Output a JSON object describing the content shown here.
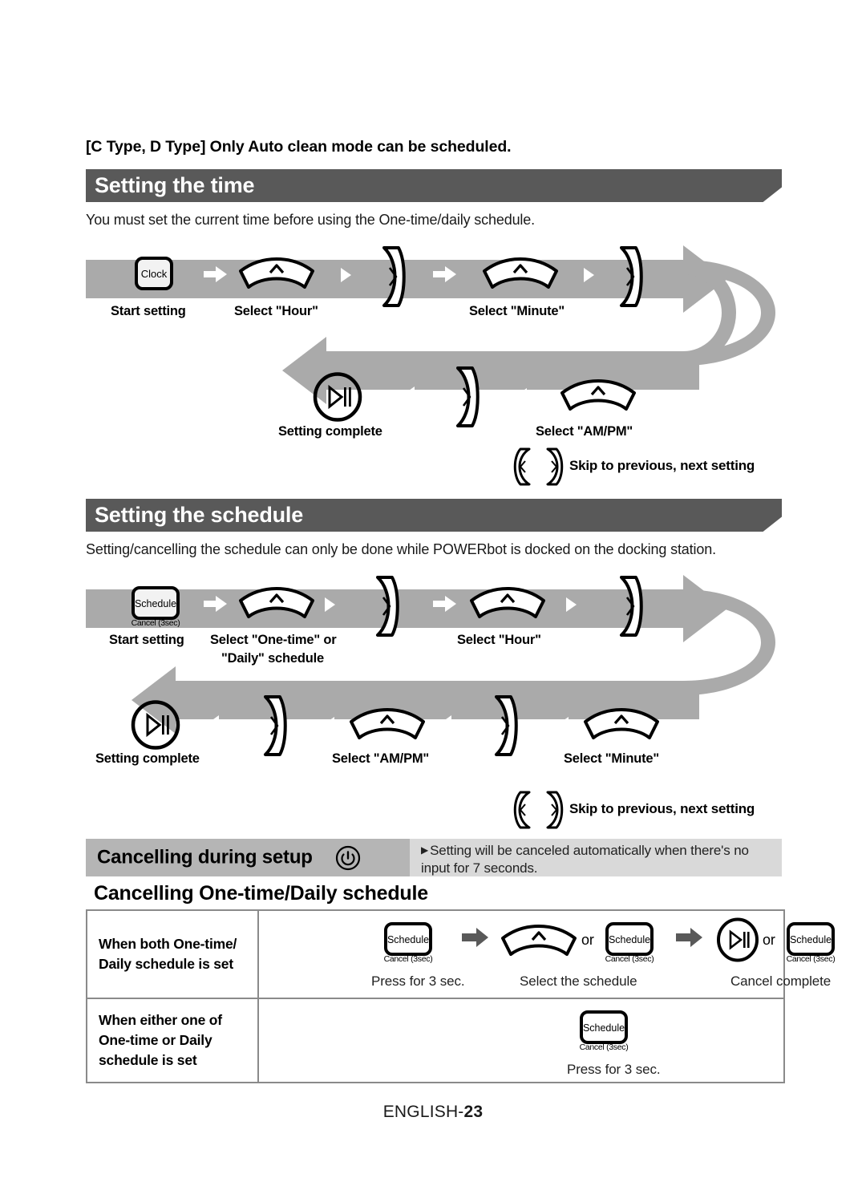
{
  "top_note": "[C Type, D Type] Only Auto clean mode can be scheduled.",
  "section_time": {
    "heading": "Setting the time",
    "intro": "You must set the current time before using the One-time/daily schedule.",
    "row1_labels": {
      "start": "Start setting",
      "hour": "Select \"Hour\"",
      "minute": "Select \"Minute\""
    },
    "row2_labels": {
      "complete": "Setting complete",
      "ampm": "Select \"AM/PM\""
    },
    "clock_button": "Clock",
    "legend": "Skip to previous, next setting"
  },
  "section_schedule": {
    "heading": "Setting the schedule",
    "intro": "Setting/cancelling the schedule can only be done while POWERbot is docked on the docking station.",
    "row1_labels": {
      "start": "Start setting",
      "mode_line1": "Select \"One-time\" or",
      "mode_line2": "\"Daily\" schedule",
      "hour": "Select \"Hour\""
    },
    "row2_labels": {
      "complete": "Setting complete",
      "ampm": "Select \"AM/PM\"",
      "minute": "Select \"Minute\""
    },
    "schedule_button": "Schedule",
    "schedule_button_sub": "Cancel (3sec)",
    "legend": "Skip to previous, next setting"
  },
  "cancelling_setup": {
    "title": "Cancelling during setup",
    "note_line1": "Setting will be canceled automatically when there's no",
    "note_line2": "input for 7 seconds.",
    "bullet": "▶"
  },
  "cancelling_schedule": {
    "title": "Cancelling One-time/Daily schedule",
    "rows": [
      {
        "label_line1": "When both One-time/",
        "label_line2": "Daily schedule is set",
        "steps": [
          {
            "caption": "Press for 3 sec."
          },
          {
            "caption": "Select the schedule"
          },
          {
            "caption": "Cancel complete"
          }
        ],
        "or_text": "or"
      },
      {
        "label_line1": "When either one of",
        "label_line2": "One-time or Daily",
        "label_line3": "schedule is set",
        "steps": [
          {
            "caption": "Press for 3 sec."
          }
        ]
      }
    ],
    "schedule_button": "Schedule",
    "schedule_button_sub": "Cancel (3sec)"
  },
  "footer": {
    "lang": "ENGLISH-",
    "page": "23"
  },
  "colors": {
    "section_bar": "#595959",
    "ribbon": "#aaaaaa",
    "strip_left": "#b5b5b5",
    "strip_right": "#d9d9d9",
    "table_border": "#8a8a8a"
  }
}
